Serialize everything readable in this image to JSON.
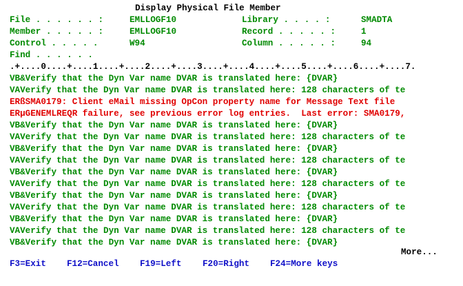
{
  "title": "Display Physical File Member",
  "header": {
    "file_label": "File . . . . . . :",
    "file_value": "EMLLOGF10",
    "library_label": "Library . . . . :",
    "library_value": "SMADTA",
    "member_label": "Member . . . . . :",
    "member_value": "EMLLOGF10",
    "record_label": "Record . . . . . :",
    "record_value": "1",
    "control_label": "Control . . . . .",
    "control_value": "W94",
    "column_label": "Column . . . . . :",
    "column_value": "94",
    "find_label": "Find . . . . . ."
  },
  "ruler": ".+....0....+....1....+....2....+....3....+....4....+....5....+....6....+....7.",
  "records": [
    "VB&Verify that the Dyn Var name DVAR is translated here: {DVAR}",
    "VAVerify that the Dyn Var name DVAR is translated here: 128 characters of te",
    "ERßSMA0179: Client eMail missing OpCon property name for Message Text file",
    "ERµGENEMLREQR failure, see previous error log entries.  Last error: SMA0179,",
    "VB&Verify that the Dyn Var name DVAR is translated here: {DVAR}",
    "VAVerify that the Dyn Var name DVAR is translated here: 128 characters of te",
    "VB&Verify that the Dyn Var name DVAR is translated here: {DVAR}",
    "VAVerify that the Dyn Var name DVAR is translated here: 128 characters of te",
    "VB&Verify that the Dyn Var name DVAR is translated here: {DVAR}",
    "VAVerify that the Dyn Var name DVAR is translated here: 128 characters of te",
    "VB&Verify that the Dyn Var name DVAR is translated here: {DVAR}",
    "VAVerify that the Dyn Var name DVAR is translated here: 128 characters of te",
    "VB&Verify that the Dyn Var name DVAR is translated here: {DVAR}",
    "VAVerify that the Dyn Var name DVAR is translated here: 128 characters of te",
    "VB&Verify that the Dyn Var name DVAR is translated here: {DVAR}"
  ],
  "more_indicator": "More...",
  "function_keys": {
    "f3": "F3=Exit",
    "f12": "F12=Cancel",
    "f19": "F19=Left",
    "f20": "F20=Right",
    "f24": "F24=More keys"
  },
  "colors": {
    "text": "#000000",
    "field": "#008a00",
    "error": "#e00000",
    "function_keys": "#1010c8"
  }
}
